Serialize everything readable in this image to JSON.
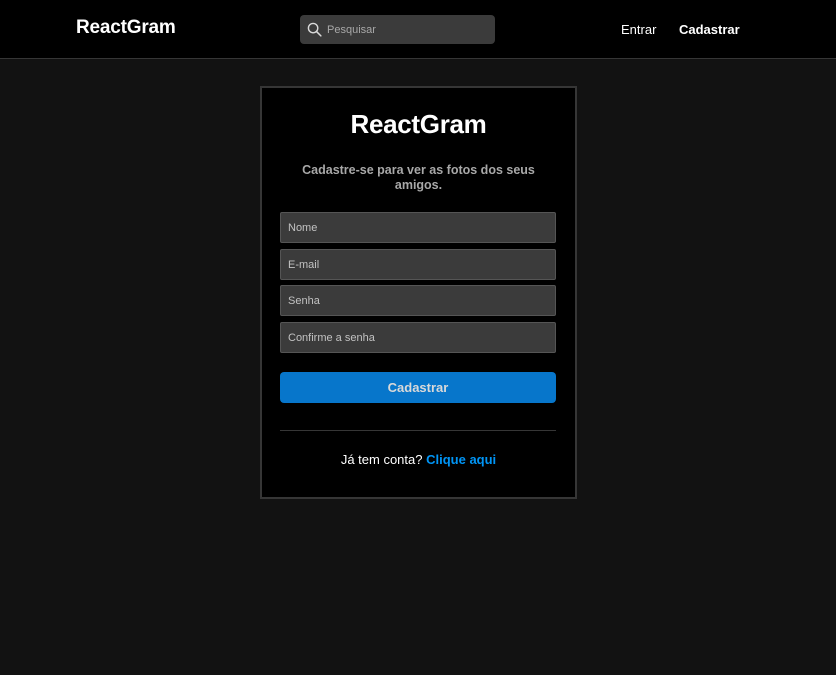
{
  "colors": {
    "page_background": "#121212",
    "navbar_background": "#000000",
    "card_background": "#000000",
    "input_background": "#3b3b3b",
    "primary_button": "#0776cb",
    "link": "#0095f6",
    "muted_text": "#a8a8a8"
  },
  "navbar": {
    "brand": "ReactGram",
    "search": {
      "placeholder": "Pesquisar",
      "icon": "search-icon"
    },
    "links": {
      "login": "Entrar",
      "register": "Cadastrar"
    }
  },
  "register_card": {
    "title": "ReactGram",
    "subtitle": "Cadastre-se para ver as fotos dos seus amigos.",
    "fields": {
      "name": {
        "placeholder": "Nome",
        "value": ""
      },
      "email": {
        "placeholder": "E-mail",
        "value": ""
      },
      "password": {
        "placeholder": "Senha",
        "value": ""
      },
      "confirm_password": {
        "placeholder": "Confirme a senha",
        "value": ""
      }
    },
    "submit_label": "Cadastrar",
    "footer": {
      "text": "Já tem conta?",
      "link": "Clique aqui"
    }
  }
}
